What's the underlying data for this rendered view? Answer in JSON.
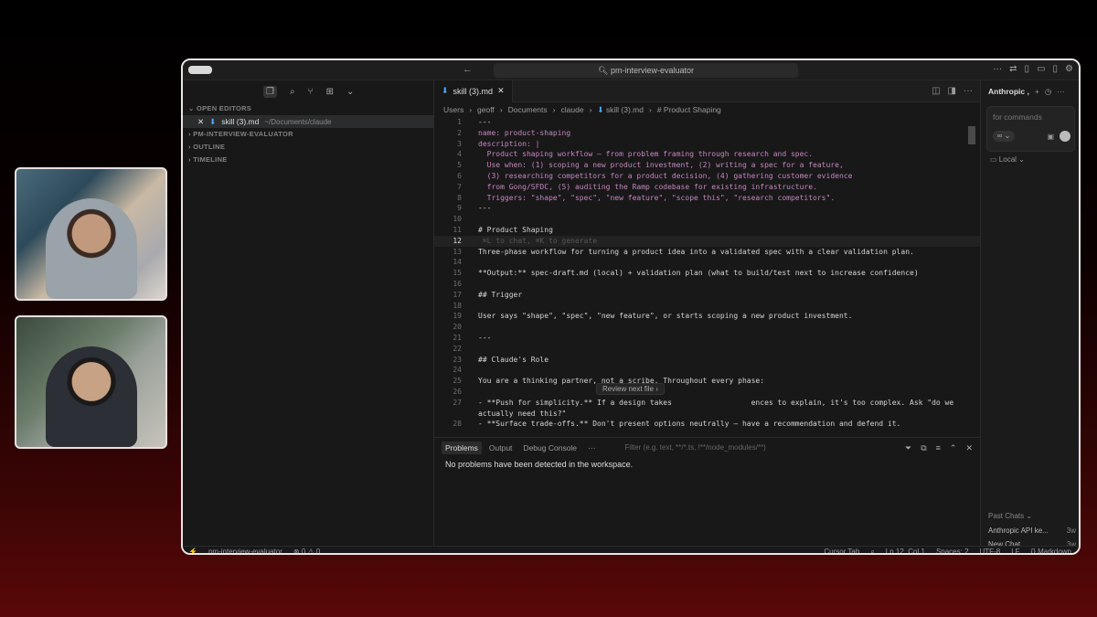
{
  "titlebar": {
    "search": "pm-interview-evaluator",
    "back_icon": "arrow-left-icon"
  },
  "sidebar": {
    "sections": {
      "open_editors": "OPEN EDITORS",
      "project": "PM-INTERVIEW-EVALUATOR",
      "outline": "OUTLINE",
      "timeline": "TIMELINE"
    },
    "open_file": {
      "name": "skill (3).md",
      "path": "~/Documents/claude"
    }
  },
  "editor": {
    "tab_label": "skill (3).md",
    "breadcrumb": [
      "Users",
      "geoff",
      "Documents",
      "claude",
      "skill (3).md",
      "# Product Shaping"
    ],
    "lines": [
      {
        "n": "1",
        "text": "---"
      },
      {
        "n": "2",
        "text": "name: product-shaping"
      },
      {
        "n": "3",
        "text": "description: |"
      },
      {
        "n": "4",
        "text": "  Product shaping workflow — from problem framing through research and spec."
      },
      {
        "n": "5",
        "text": "  Use when: (1) scoping a new product investment, (2) writing a spec for a feature,"
      },
      {
        "n": "6",
        "text": "  (3) researching competitors for a product decision, (4) gathering customer evidence"
      },
      {
        "n": "7",
        "text": "  from Gong/SFDC, (5) auditing the Ramp codebase for existing infrastructure."
      },
      {
        "n": "8",
        "text": "  Triggers: \"shape\", \"spec\", \"new feature\", \"scope this\", \"research competitors\"."
      },
      {
        "n": "9",
        "text": "---"
      },
      {
        "n": "10",
        "text": ""
      },
      {
        "n": "11",
        "text": "# Product Shaping"
      },
      {
        "n": "12",
        "text": " ⌘L to chat, ⌘K to generate"
      },
      {
        "n": "13",
        "text": "Three-phase workflow for turning a product idea into a validated spec with a clear validation plan."
      },
      {
        "n": "14",
        "text": ""
      },
      {
        "n": "15",
        "text": "**Output:** spec-draft.md (local) + validation plan (what to build/test next to increase confidence)"
      },
      {
        "n": "16",
        "text": ""
      },
      {
        "n": "17",
        "text": "## Trigger"
      },
      {
        "n": "18",
        "text": ""
      },
      {
        "n": "19",
        "text": "User says \"shape\", \"spec\", \"new feature\", or starts scoping a new product investment."
      },
      {
        "n": "20",
        "text": ""
      },
      {
        "n": "21",
        "text": "---"
      },
      {
        "n": "22",
        "text": ""
      },
      {
        "n": "23",
        "text": "## Claude's Role"
      },
      {
        "n": "24",
        "text": ""
      },
      {
        "n": "25",
        "text": "You are a thinking partner, not a scribe. Throughout every phase:"
      },
      {
        "n": "26",
        "text": ""
      },
      {
        "n": "27",
        "text": "- **Push for simplicity.** If a design takes                  ences to explain, it's too complex. Ask \"do we"
      },
      {
        "n": "",
        "text": "actually need this?\""
      },
      {
        "n": "28",
        "text": "- **Surface trade-offs.** Don't present options neutrally — have a recommendation and defend it."
      }
    ],
    "review_popup": "Review next file  ›"
  },
  "panel": {
    "tabs": [
      "Problems",
      "Output",
      "Debug Console",
      "···"
    ],
    "filter_placeholder": "Filter (e.g. text, **/*.ts, !**/node_modules/**)",
    "message": "No problems have been detected in the workspace."
  },
  "chat": {
    "title": "Anthropic ,",
    "placeholder": "for commands",
    "infinity": "∞ ⌄",
    "local": "Local ⌄",
    "past_heading": "Past Chats ⌄",
    "past": [
      {
        "name": "Anthropic API ke...",
        "time": "3w"
      },
      {
        "name": "New Chat",
        "time": "3w"
      }
    ]
  },
  "statusbar": {
    "project": "pm-interview-evaluator",
    "problems": "⊗ 0 ⚠ 0",
    "cursor_tab": "Cursor Tab",
    "position": "Ln 12, Col 1",
    "spaces": "Spaces: 2",
    "encoding": "UTF-8",
    "eol": "LF",
    "language": "{} Markdown"
  }
}
